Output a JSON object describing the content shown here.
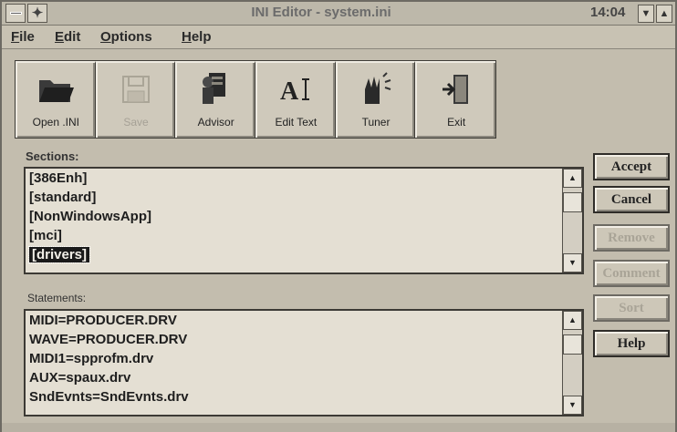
{
  "titlebar": {
    "title": "INI Editor - system.ini",
    "clock": "14:04",
    "minimize": "▼",
    "maximize": "▲"
  },
  "menu": {
    "file": "File",
    "edit": "Edit",
    "options": "Options",
    "help": "Help"
  },
  "toolbar": {
    "open": "Open .INI",
    "save": "Save",
    "advisor": "Advisor",
    "edit_text": "Edit Text",
    "tuner": "Tuner",
    "exit": "Exit"
  },
  "sections": {
    "label": "Sections:",
    "items": [
      "[386Enh]",
      "[standard]",
      "[NonWindowsApp]",
      "[mci]",
      "[drivers]"
    ],
    "selected": "[drivers]"
  },
  "statements": {
    "label": "Statements:",
    "items": [
      "MIDI=PRODUCER.DRV",
      "WAVE=PRODUCER.DRV",
      "MIDI1=spprofm.drv",
      "AUX=spaux.drv",
      "SndEvnts=SndEvnts.drv"
    ]
  },
  "buttons": {
    "accept": "Accept",
    "cancel": "Cancel",
    "remove": "Remove",
    "comment": "Comment",
    "sort": "Sort",
    "help": "Help"
  },
  "icons": {
    "open": "folder-open-icon",
    "save": "floppy-disk-icon",
    "advisor": "advisor-icon",
    "edit_text": "edit-text-icon",
    "tuner": "tuner-icon",
    "exit": "exit-door-icon"
  }
}
